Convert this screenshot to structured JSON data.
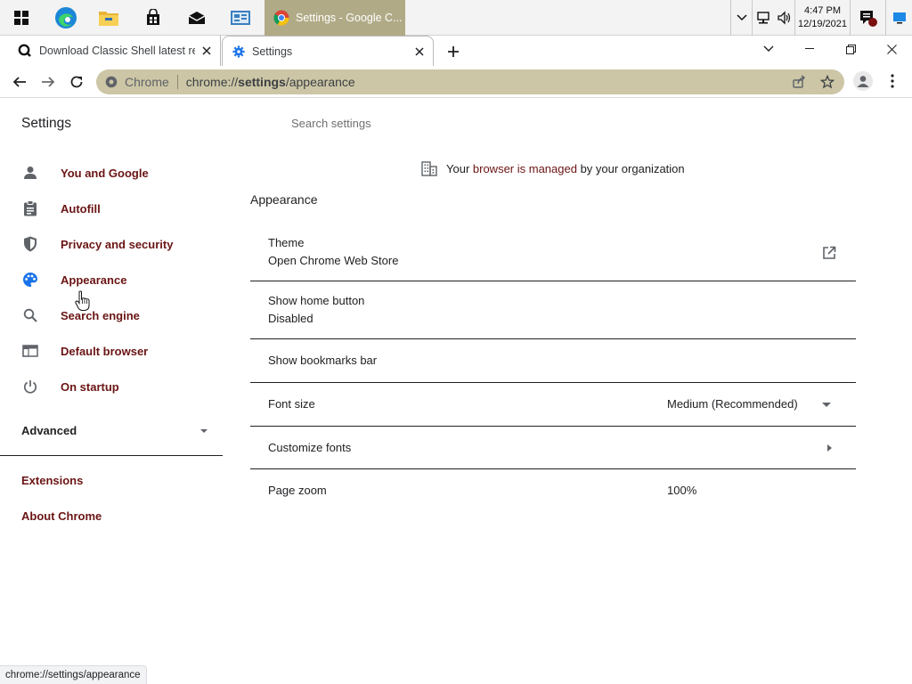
{
  "taskbar": {
    "start_icon": "windows-start-icon",
    "pinned": [
      "edge-icon",
      "file-explorer-icon",
      "store-icon",
      "mail-icon",
      "control-panel-icon"
    ],
    "active_window_label": "Settings - Google C...",
    "tray_icons": [
      "chevron-up-icon",
      "network-icon",
      "volume-icon",
      "notification-icon",
      "desktop-icon"
    ],
    "clock_time": "4:47 PM",
    "clock_date": "12/19/2021"
  },
  "tabs": [
    {
      "title": "Download Classic Shell latest rele",
      "icon": "site-icon",
      "active": false
    },
    {
      "title": "Settings",
      "icon": "gear-icon",
      "active": true
    }
  ],
  "omnibox": {
    "chip": "Chrome",
    "url_host": "chrome://",
    "url_path_bold": "settings",
    "url_rest": "/appearance"
  },
  "settings": {
    "title": "Settings",
    "search_placeholder": "Search settings",
    "nav": [
      {
        "label": "You and Google",
        "icon": "person-icon"
      },
      {
        "label": "Autofill",
        "icon": "clipboard-icon"
      },
      {
        "label": "Privacy and security",
        "icon": "shield-icon"
      },
      {
        "label": "Appearance",
        "icon": "palette-icon"
      },
      {
        "label": "Search engine",
        "icon": "search-icon"
      },
      {
        "label": "Default browser",
        "icon": "browser-window-icon"
      },
      {
        "label": "On startup",
        "icon": "power-icon"
      }
    ],
    "advanced_label": "Advanced",
    "links": [
      "Extensions",
      "About Chrome"
    ]
  },
  "managed_notice": {
    "prefix": "Your ",
    "link": "browser is managed",
    "suffix": " by your organization"
  },
  "appearance": {
    "section_title": "Appearance",
    "theme_label": "Theme",
    "theme_sub": "Open Chrome Web Store",
    "home_button_label": "Show home button",
    "home_button_sub": "Disabled",
    "bookmarks_bar_label": "Show bookmarks bar",
    "font_size_label": "Font size",
    "font_size_value": "Medium (Recommended)",
    "customize_fonts_label": "Customize fonts",
    "page_zoom_label": "Page zoom",
    "page_zoom_value": "100%"
  },
  "status_bar": "chrome://settings/appearance",
  "colors": {
    "link": "#6b1414",
    "omnibox_bg": "#ccc6a6",
    "active_taskbar_bg": "#b0aa86"
  }
}
